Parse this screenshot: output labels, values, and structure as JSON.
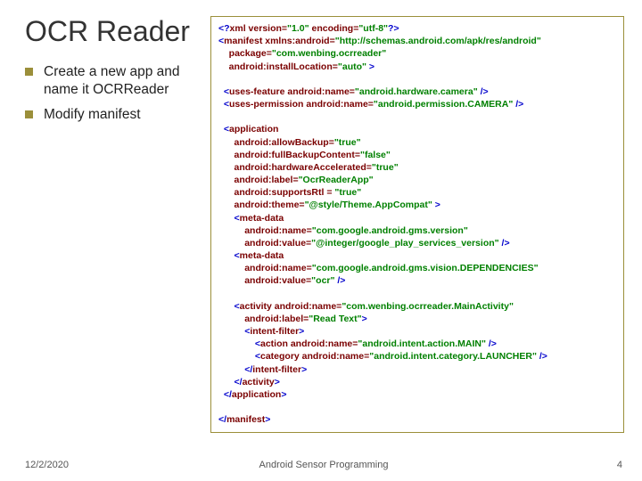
{
  "title": "OCR Reader",
  "bullets": [
    "Create a new app and name it OCRReader",
    "Modify manifest"
  ],
  "code": {
    "l1a": "<?",
    "l1b": "xml version=",
    "l1c": "\"1.0\"",
    "l1d": " encoding=",
    "l1e": "\"utf-8\"",
    "l1f": "?>",
    "l2a": "<",
    "l2b": "manifest",
    "l2c": " xmlns:android=",
    "l2d": "\"http://schemas.android.com/apk/res/android\"",
    "l3a": "    package=",
    "l3b": "\"com.wenbing.ocrreader\"",
    "l4a": "    android:installLocation=",
    "l4b": "\"auto\"",
    "l4c": " >",
    "l5a": "  <",
    "l5b": "uses-feature",
    "l5c": " android:name=",
    "l5d": "\"android.hardware.camera\"",
    "l5e": " />",
    "l6a": "  <",
    "l6b": "uses-permission",
    "l6c": " android:name=",
    "l6d": "\"android.permission.CAMERA\"",
    "l6e": " />",
    "l7a": "  <",
    "l7b": "application",
    "l8a": "      android:allowBackup=",
    "l8b": "\"true\"",
    "l9a": "      android:fullBackupContent=",
    "l9b": "\"false\"",
    "l10a": "      android:hardwareAccelerated=",
    "l10b": "\"true\"",
    "l11a": "      android:label=",
    "l11b": "\"OcrReaderApp\"",
    "l12a": "      android:supportsRtl = ",
    "l12b": "\"true\"",
    "l13a": "      android:theme=",
    "l13b": "\"@style/Theme.AppCompat\"",
    "l13c": " >",
    "l14a": "      <",
    "l14b": "meta-data",
    "l15a": "          android:name=",
    "l15b": "\"com.google.android.gms.version\"",
    "l16a": "          android:value=",
    "l16b": "\"@integer/google_play_services_version\"",
    "l16c": " />",
    "l17a": "      <",
    "l17b": "meta-data",
    "l18a": "          android:name=",
    "l18b": "\"com.google.android.gms.vision.DEPENDENCIES\"",
    "l19a": "          android:value=",
    "l19b": "\"ocr\"",
    "l19c": " />",
    "l20a": "      <",
    "l20b": "activity",
    "l20c": " android:name=",
    "l20d": "\"com.wenbing.ocrreader.MainActivity\"",
    "l21a": "          android:label=",
    "l21b": "\"Read Text\"",
    "l21c": ">",
    "l22a": "          <",
    "l22b": "intent-filter",
    "l22c": ">",
    "l23a": "              <",
    "l23b": "action",
    "l23c": " android:name=",
    "l23d": "\"android.intent.action.MAIN\"",
    "l23e": " />",
    "l24a": "              <",
    "l24b": "category",
    "l24c": " android:name=",
    "l24d": "\"android.intent.category.LAUNCHER\"",
    "l24e": " />",
    "l25a": "          </",
    "l25b": "intent-filter",
    "l25c": ">",
    "l26a": "      </",
    "l26b": "activity",
    "l26c": ">",
    "l27a": "  </",
    "l27b": "application",
    "l27c": ">",
    "l28a": "</",
    "l28b": "manifest",
    "l28c": ">"
  },
  "footer": {
    "date": "12/2/2020",
    "center": "Android Sensor Programming",
    "page": "4"
  }
}
